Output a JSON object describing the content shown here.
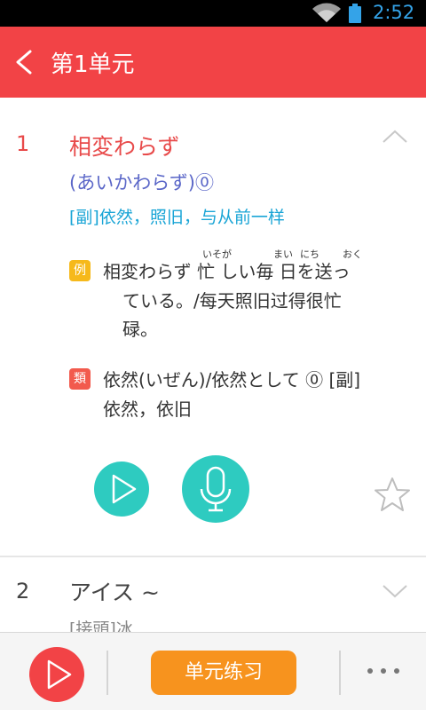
{
  "status_bar": {
    "time": "2:52"
  },
  "header": {
    "title": "第1单元"
  },
  "words": [
    {
      "number": "1",
      "word": "相変わらず",
      "reading": "(あいかわらず)⓪",
      "meaning": "[副]依然，照旧，与从前一样",
      "example_tag": "例",
      "example": {
        "furigana": [
          "いそが",
          "まい",
          "にち",
          "おく"
        ],
        "line1": "相変わらず 忙 しい毎 日を送っ",
        "line2": "ている。/每天照旧过得很忙",
        "line3": "碌。"
      },
      "similar_tag": "類",
      "similar": {
        "line1": "依然(いぜん)/依然として ⓪ [副]",
        "line2": "依然，依旧"
      }
    },
    {
      "number": "2",
      "word": "アイス ~",
      "meaning": "[接頭]冰"
    }
  ],
  "bottom_bar": {
    "practice_label": "单元练习"
  },
  "colors": {
    "accent": "#f24346",
    "teal": "#2ecbc0",
    "orange": "#f7931e"
  }
}
